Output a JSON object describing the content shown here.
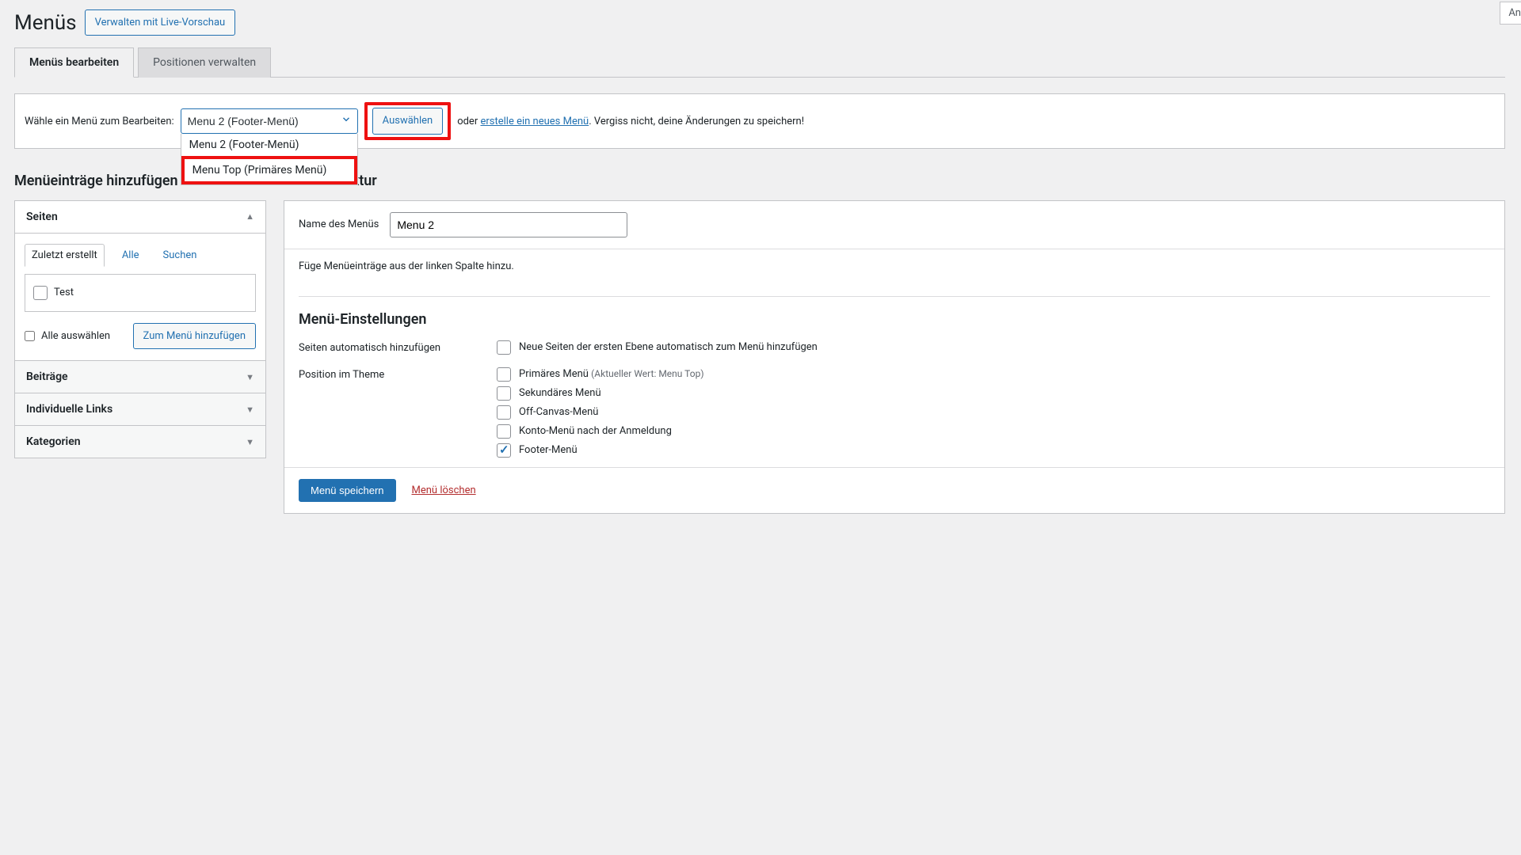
{
  "header": {
    "page_title": "Menüs",
    "live_preview_btn": "Verwalten mit Live-Vorschau",
    "top_right_stub": "An"
  },
  "tabs": {
    "edit": "Menüs bearbeiten",
    "positions": "Positionen verwalten"
  },
  "select_bar": {
    "label": "Wähle ein Menü zum Bearbeiten:",
    "selected": "Menu 2 (Footer-Menü)",
    "options": [
      "Menu 2 (Footer-Menü)",
      "Menu Top (Primäres Menü)"
    ],
    "choose_btn": "Auswählen",
    "or_text": "oder ",
    "create_link": "erstelle ein neues Menü",
    "reminder": ". Vergiss nicht, deine Änderungen zu speichern!"
  },
  "left": {
    "heading": "Menüeinträge hinzufügen",
    "boxes": {
      "pages": {
        "title": "Seiten",
        "tabs": {
          "recent": "Zuletzt erstellt",
          "all": "Alle",
          "search": "Suchen"
        },
        "items": [
          "Test"
        ],
        "select_all": "Alle auswählen",
        "add_btn": "Zum Menü hinzufügen"
      },
      "posts": {
        "title": "Beiträge"
      },
      "custom": {
        "title": "Individuelle Links"
      },
      "categories": {
        "title": "Kategorien"
      }
    }
  },
  "right": {
    "heading": "Menü-Struktur",
    "name_label": "Name des Menüs",
    "name_value": "Menu 2",
    "hint": "Füge Menüeinträge aus der linken Spalte hinzu.",
    "settings": {
      "heading": "Menü-Einstellungen",
      "auto_add_label": "Seiten automatisch hinzufügen",
      "auto_add_desc": "Neue Seiten der ersten Ebene automatisch zum Menü hinzufügen",
      "position_label": "Position im Theme",
      "locations": [
        {
          "label": "Primäres Menü",
          "sub": "(Aktueller Wert: Menu Top)",
          "checked": false
        },
        {
          "label": "Sekundäres Menü",
          "sub": "",
          "checked": false
        },
        {
          "label": "Off-Canvas-Menü",
          "sub": "",
          "checked": false
        },
        {
          "label": "Konto-Menü nach der Anmeldung",
          "sub": "",
          "checked": false
        },
        {
          "label": "Footer-Menü",
          "sub": "",
          "checked": true
        }
      ]
    },
    "save_btn": "Menü speichern",
    "delete_link": "Menü löschen"
  }
}
